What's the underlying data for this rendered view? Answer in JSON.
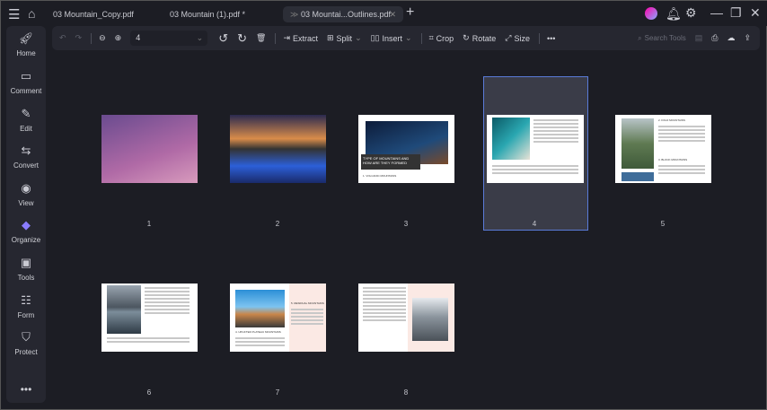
{
  "tabs": [
    {
      "label": "03 Mountain_Copy.pdf"
    },
    {
      "label": "03 Mountain (1).pdf *"
    },
    {
      "label": "03 Mountai...Outlines.pdf",
      "active": true
    }
  ],
  "sidebar": {
    "items": [
      {
        "label": "Home"
      },
      {
        "label": "Comment"
      },
      {
        "label": "Edit"
      },
      {
        "label": "Convert"
      },
      {
        "label": "View"
      },
      {
        "label": "Organize",
        "active": true
      },
      {
        "label": "Tools"
      },
      {
        "label": "Form"
      },
      {
        "label": "Protect"
      }
    ]
  },
  "toolbar": {
    "page_value": "4",
    "extract": "Extract",
    "split": "Split",
    "insert": "Insert",
    "crop": "Crop",
    "rotate": "Rotate",
    "size": "Size",
    "search_placeholder": "Search Tools"
  },
  "pages": [
    {
      "num": "1"
    },
    {
      "num": "2"
    },
    {
      "num": "3",
      "heading": "TYPE OF MOUNTAINS AND HOW ARE THEY FORMED",
      "sub": "1. VOLCANIC MOUNTAINS"
    },
    {
      "num": "4",
      "selected": true
    },
    {
      "num": "5",
      "heading": "2. FOLD MOUNTAINS",
      "sub": "3. BLOCK MOUNTAINS"
    },
    {
      "num": "6"
    },
    {
      "num": "7",
      "heading": "5. RESIDUAL MOUNTAINS",
      "sub": "4. UPLIFTED PLATEAU MOUNTAINS"
    },
    {
      "num": "8"
    }
  ],
  "colors": {
    "selection": "#5a7bd8",
    "background": "#1c1d24"
  }
}
